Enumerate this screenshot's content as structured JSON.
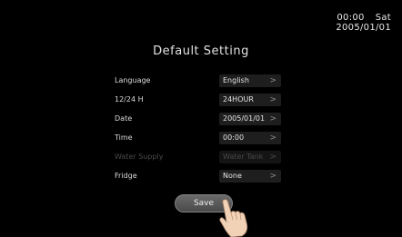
{
  "clock": {
    "time": "00:00",
    "weekday": "Sat",
    "date": "2005/01/01"
  },
  "title": "Default Setting",
  "settings": [
    {
      "label": "Language",
      "value": "English",
      "enabled": true
    },
    {
      "label": "12/24 H",
      "value": "24HOUR",
      "enabled": true
    },
    {
      "label": "Date",
      "value": "2005/01/01",
      "enabled": true
    },
    {
      "label": "Time",
      "value": "00:00",
      "enabled": true
    },
    {
      "label": "Water Supply",
      "value": "Water Tank",
      "enabled": false
    },
    {
      "label": "Fridge",
      "value": "None",
      "enabled": true
    }
  ],
  "save_label": "Save",
  "chevron": ">",
  "icons": {
    "chevron": "chevron-right-icon",
    "pointer": "hand-pointer-icon"
  },
  "colors": {
    "background": "#000000",
    "field": "#1e1e1e",
    "text": "#e6e6e6",
    "disabled": "#4a4a4a",
    "button": "#5a5a5a"
  }
}
